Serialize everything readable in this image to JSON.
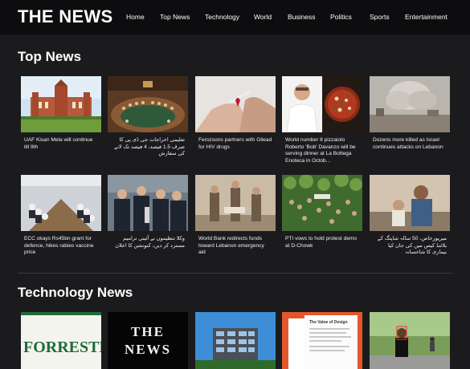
{
  "site": {
    "logo": "THE NEWS"
  },
  "nav": {
    "items": [
      {
        "label": "Home",
        "name": "nav-home"
      },
      {
        "label": "Top News",
        "name": "nav-top-news"
      },
      {
        "label": "Technology",
        "name": "nav-technology"
      },
      {
        "label": "World",
        "name": "nav-world"
      },
      {
        "label": "Business",
        "name": "nav-business"
      },
      {
        "label": "Politics",
        "name": "nav-politics"
      },
      {
        "label": "Sports",
        "name": "nav-sports"
      },
      {
        "label": "Entertainment",
        "name": "nav-entertainment"
      }
    ]
  },
  "top_news": {
    "title": "Top News",
    "row1": [
      {
        "caption": "UAF Kisan Mela will continue till 9th"
      },
      {
        "caption": "تعلیمی اخراجات جی ڈی پی کا صرف 1.5 فیصد، 4 فیصد تک لانے کی سفارش"
      },
      {
        "caption": "Ferozsons partners with Gilead for HIV drugs"
      },
      {
        "caption": "World number 8 pizzaiolo Roberto 'Bob' Davanzo will be serving dinner at La Bottega Enoteca in Octob..."
      },
      {
        "caption": "Dozens more killed as Israel continues attacks on Lebanon"
      }
    ],
    "row2": [
      {
        "caption": "ECC okays Rs45bn grant for defence, hikes rabies vaccine price"
      },
      {
        "caption": "وکلا تنظیموں نے آئینی ترامیم مسترد کر دیں، کنونشن کا اعلان"
      },
      {
        "caption": "World Bank redirects funds toward Lebanon emergency aid"
      },
      {
        "caption": "PTI vows to hold protest demo at D-Chowk"
      },
      {
        "caption": "میرپورخاص، 50 سالہ شاپنگ کے بلائنڈ کیس میں کی جان کیا بیماری کا شاخسانہ"
      }
    ]
  },
  "technology_news": {
    "title": "Technology News"
  },
  "thumbnails": {
    "forrester_word": "FORRESTER",
    "thenews_line1": "THE",
    "thenews_line2": "NEWS",
    "design_card_title": "The Value of Design"
  }
}
